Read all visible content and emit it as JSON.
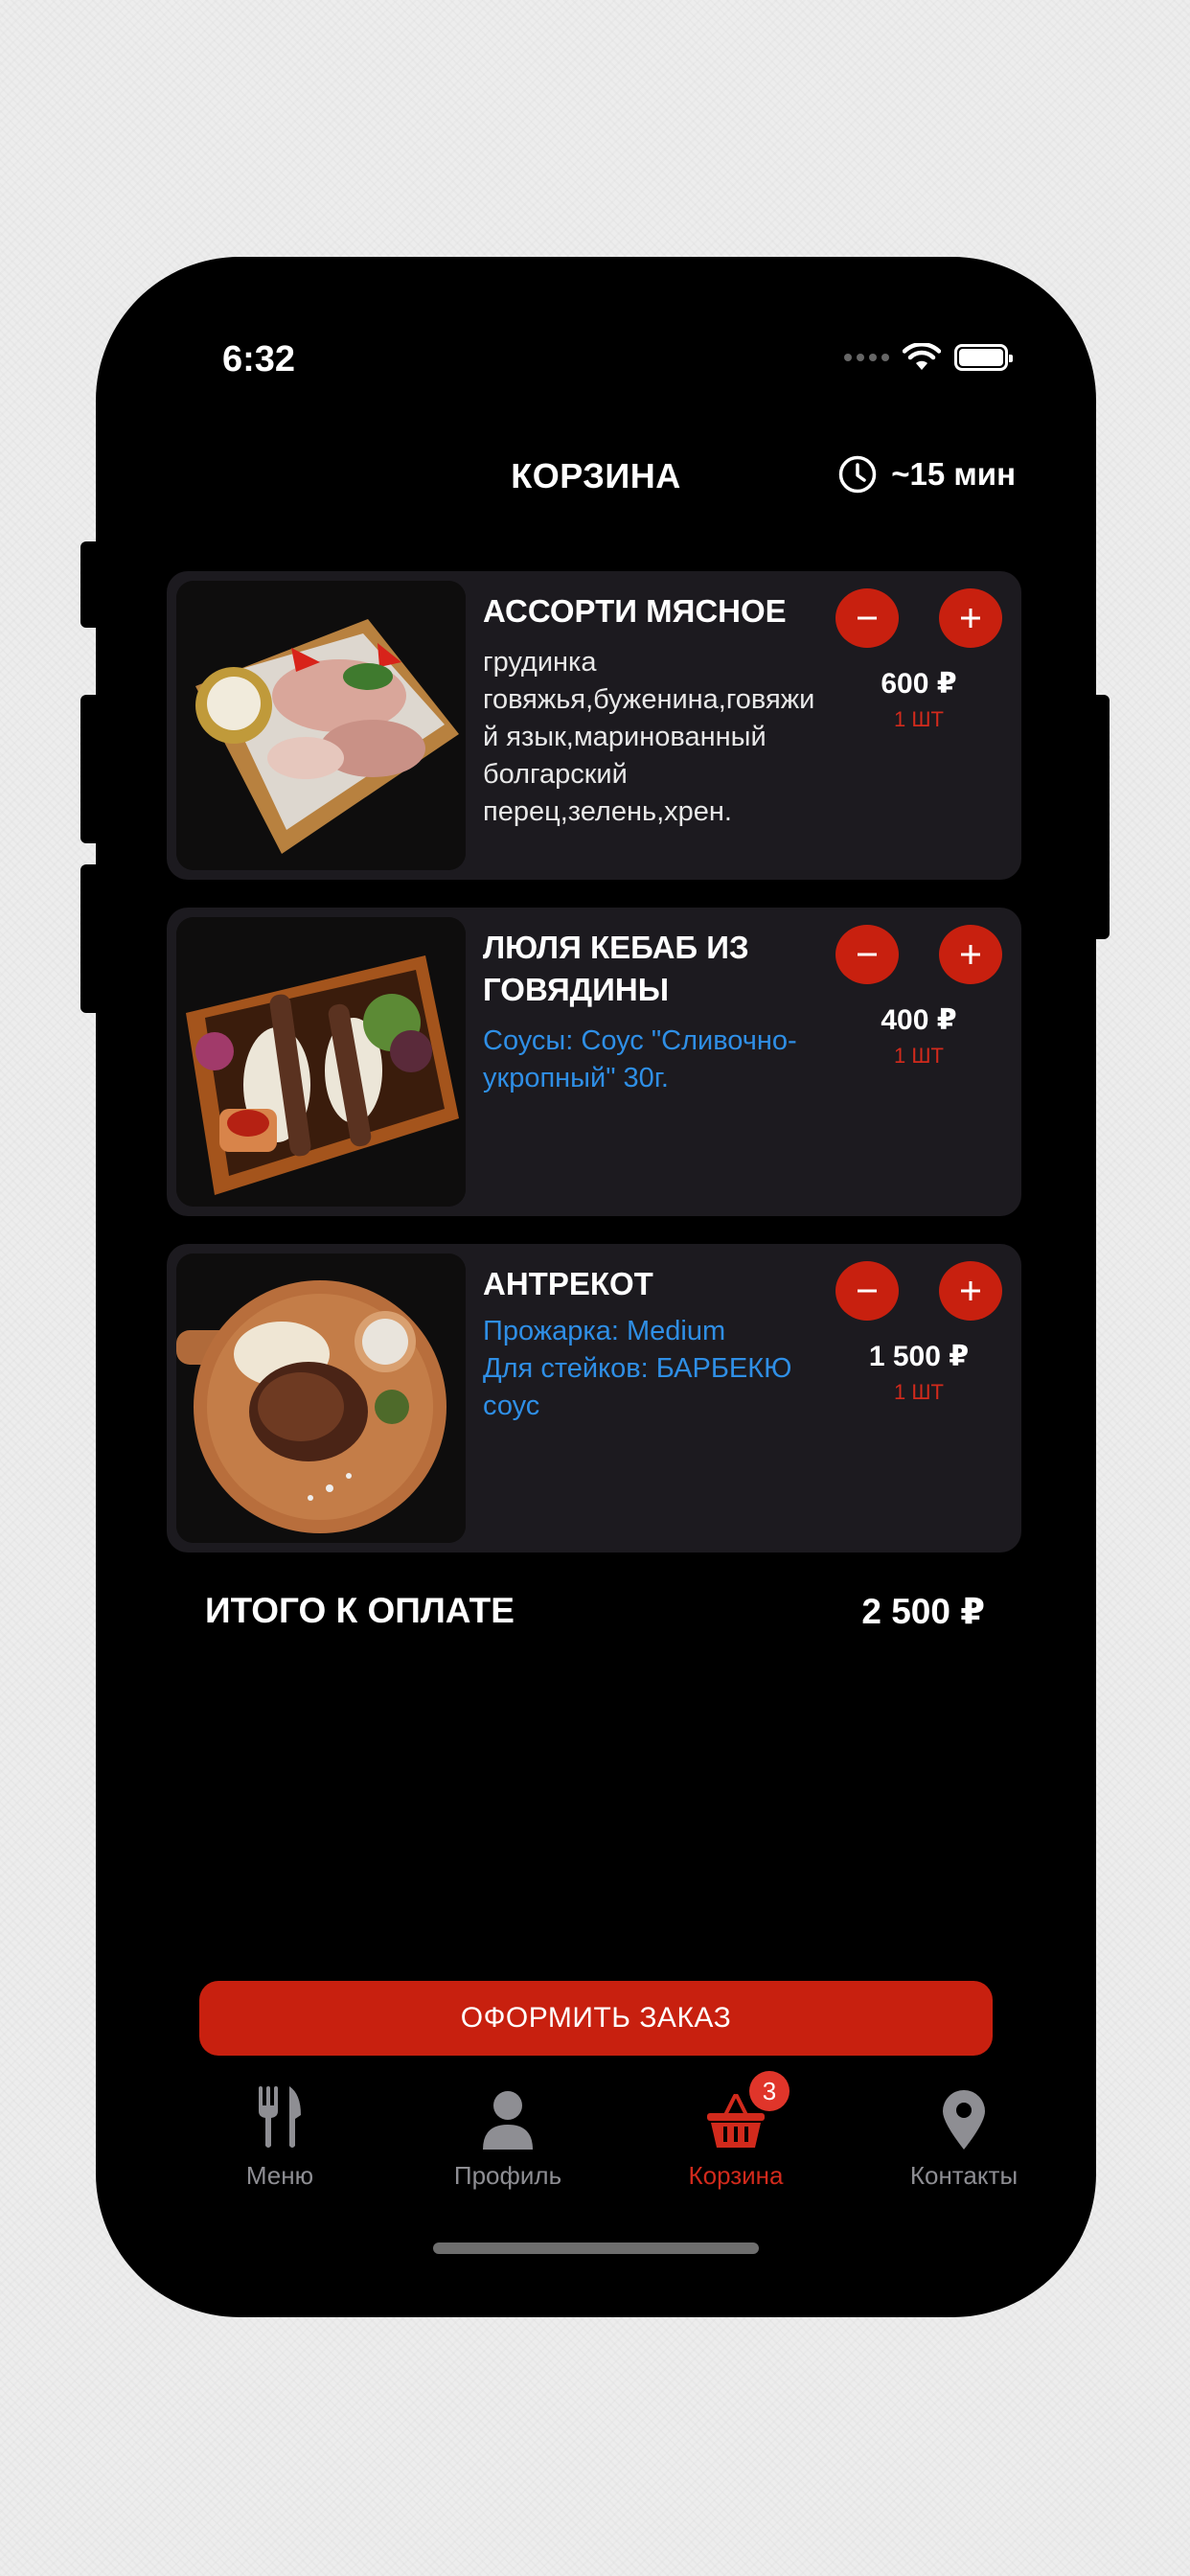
{
  "status_bar": {
    "time": "6:32"
  },
  "header": {
    "title": "КОРЗИНА",
    "eta": "~15 мин"
  },
  "items": [
    {
      "name": "АССОРТИ МЯСНОЕ",
      "description": "грудинка говяжья,буженина,говяжий язык,маринованный болгарский перец,зелень,хрен.",
      "options": "",
      "price": "600 ₽",
      "quantity": "1 ШТ"
    },
    {
      "name": "ЛЮЛЯ КЕБАБ ИЗ ГОВЯДИНЫ",
      "description": "",
      "options": "Соусы: Соус \"Сливочно-укропный\" 30г.",
      "price": "400 ₽",
      "quantity": "1 ШТ"
    },
    {
      "name": "АНТРЕКОТ",
      "description": "",
      "options": "Прожарка: Medium\nДля стейков: БАРБЕКЮ соус",
      "price": "1 500 ₽",
      "quantity": "1 ШТ"
    }
  ],
  "total": {
    "label": "ИТОГО К ОПЛАТЕ",
    "value": "2 500 ₽"
  },
  "checkout_label": "ОФОРМИТЬ ЗАКАЗ",
  "tabs": [
    {
      "label": "Меню",
      "icon": "fork-knife-icon"
    },
    {
      "label": "Профиль",
      "icon": "person-icon"
    },
    {
      "label": "Корзина",
      "icon": "basket-icon",
      "badge": "3"
    },
    {
      "label": "Контакты",
      "icon": "location-pin-icon"
    }
  ],
  "colors": {
    "accent": "#c8200f",
    "card": "#1c1a1f",
    "options_text": "#2f8fe6",
    "inactive_tab": "#8e8e93"
  }
}
